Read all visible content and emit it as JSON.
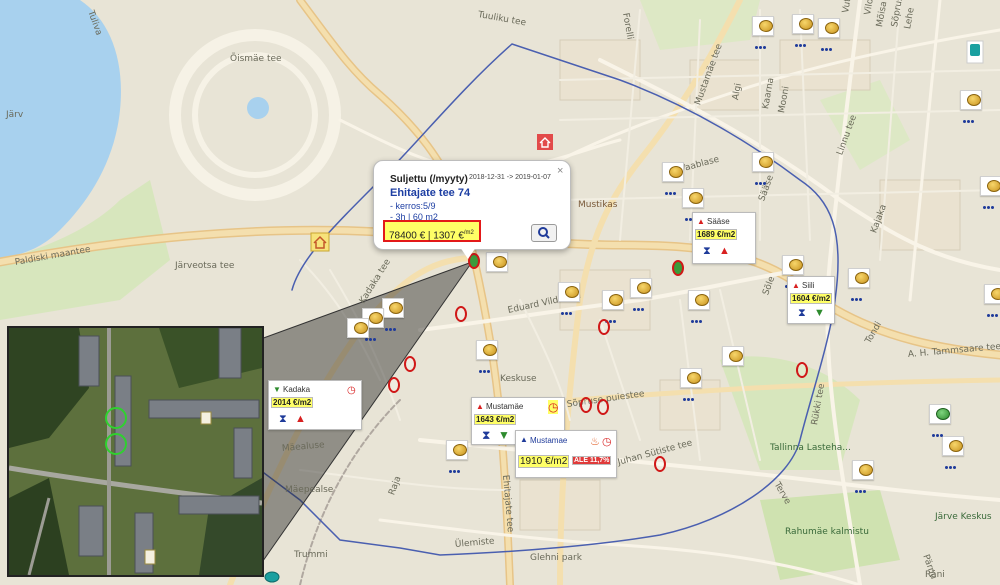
{
  "map": {
    "background_color": "#e8e4d6",
    "water_color": "#a8d1ee",
    "park_color": "#cfe2b0",
    "district_border_color": "#4a5fb0",
    "streets": [
      {
        "name": "Paldiski maantee"
      },
      {
        "name": "Järveotsa tee"
      },
      {
        "name": "Õismäe tee"
      },
      {
        "name": "Kadaka tee"
      },
      {
        "name": "Ehitajate tee"
      },
      {
        "name": "Mustamäe tee"
      },
      {
        "name": "Forelli"
      },
      {
        "name": "Algi"
      },
      {
        "name": "Kaarna"
      },
      {
        "name": "Mooni"
      },
      {
        "name": "Linnu tee"
      },
      {
        "name": "Vaablase"
      },
      {
        "name": "Sääse"
      },
      {
        "name": "Kajaka"
      },
      {
        "name": "Sõle"
      },
      {
        "name": "Tondi"
      },
      {
        "name": "A. H. Tammsaare tee"
      },
      {
        "name": "Eduard Vilde tee"
      },
      {
        "name": "Keskuse"
      },
      {
        "name": "Sõpruse puiestee"
      },
      {
        "name": "Juhan Sütiste tee"
      },
      {
        "name": "Raja"
      },
      {
        "name": "Mäepealse"
      },
      {
        "name": "Mäealuse"
      },
      {
        "name": "Trummi"
      },
      {
        "name": "Ülemiste"
      },
      {
        "name": "Rükki tee"
      },
      {
        "name": "Mustikas"
      },
      {
        "name": "Tallinna Lasteha..."
      },
      {
        "name": "Rahumäe kalmistu"
      },
      {
        "name": "Järve Keskus"
      },
      {
        "name": "Pärnu"
      },
      {
        "name": "Vilde"
      },
      {
        "name": "Mõisa"
      },
      {
        "name": "Sõpruse"
      },
      {
        "name": "Lehe"
      },
      {
        "name": "Vuti"
      },
      {
        "name": "Glehni park"
      },
      {
        "name": "Tuuliku tee"
      },
      {
        "name": "Terve"
      },
      {
        "name": "Räni"
      },
      {
        "name": "Tuliva"
      },
      {
        "name": "Järv"
      }
    ]
  },
  "popup": {
    "status": "Suljettu (/myyty)",
    "dates": "2018-12-31 -> 2019-01-07",
    "close_label": "×",
    "street": "Ehitajate tee 74",
    "floor_line": "- kerros:5/9",
    "rooms_line": "- 3h | 60 m2",
    "price": "78400 € | 1307 €",
    "price_unit": "/m2",
    "zoom_icon": "magnifier-icon",
    "price_highlight": "#ffff66",
    "price_border": "#e31919"
  },
  "areas": {
    "kadaka": {
      "name": "Kadaka",
      "value": "2014 €/m2",
      "trend": "down"
    },
    "mustamae1": {
      "name": "Mustamäe",
      "value": "1643 €/m2",
      "trend": "up"
    },
    "mustamae2": {
      "name": "Mustamae",
      "value": "1910 €/m2",
      "discount": "ALE 11,7%",
      "trend": "up"
    },
    "saase": {
      "name": "Sääse",
      "value": "1689 €/m2",
      "trend": "up"
    },
    "siili": {
      "name": "Siili",
      "value": "1604 €/m2",
      "trend": "down"
    }
  },
  "legend_colors": {
    "up": "#d82020",
    "down": "#2e8b2e",
    "coin": "#e2b43a",
    "ring": "#d01818"
  }
}
